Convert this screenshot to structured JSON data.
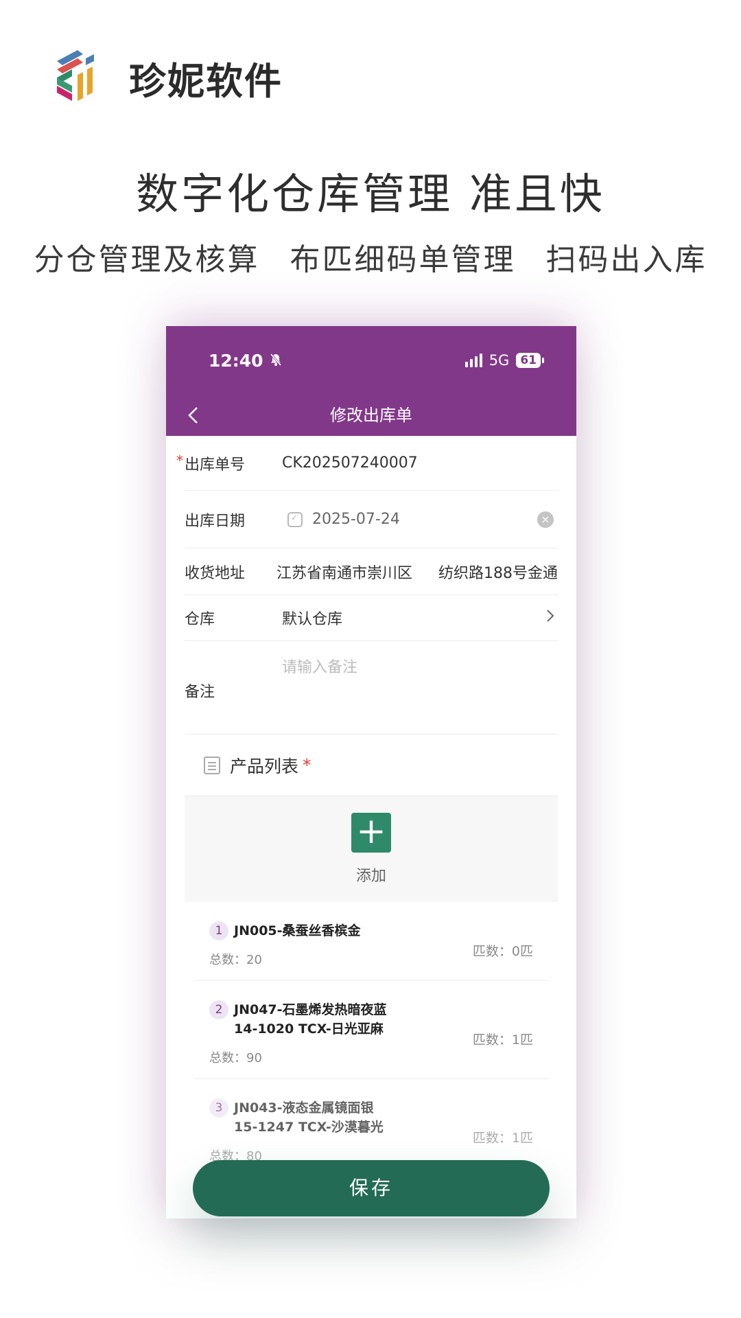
{
  "brand": {
    "name": "珍妮软件",
    "logo_icon": "stacked-stripes-logo-icon"
  },
  "headline": "数字化仓库管理 准且快",
  "features": [
    "分仓管理及核算",
    "布匹细码单管理",
    "扫码出入库"
  ],
  "phone": {
    "status": {
      "time": "12:40",
      "network": "5G",
      "battery": "61",
      "mute_icon": "bell-slash-icon"
    },
    "nav": {
      "title": "修改出库单",
      "back_icon": "chevron-left-icon"
    },
    "form": {
      "order_no": {
        "label": "出库单号",
        "value": "CK202507240007"
      },
      "date": {
        "label": "出库日期",
        "value": "2025-07-24"
      },
      "address": {
        "label": "收货地址",
        "part1": "江苏省南通市崇川区",
        "part2": "纺织路188号金通"
      },
      "warehouse": {
        "label": "仓库",
        "value": "默认仓库"
      },
      "remark": {
        "label": "备注",
        "placeholder": "请输入备注"
      }
    },
    "products": {
      "title": "产品列表",
      "required_mark": "*",
      "add_label": "添加",
      "items": [
        {
          "index": "1",
          "name": "JN005-桑蚕丝香槟金",
          "name2": "",
          "total": "总数：20",
          "pieces": "匹数：0匹"
        },
        {
          "index": "2",
          "name": "JN047-石墨烯发热暗夜蓝",
          "name2": "14-1020 TCX-日光亚麻",
          "total": "总数：90",
          "pieces": "匹数：1匹"
        },
        {
          "index": "3",
          "name": "JN043-液态金属镜面银",
          "name2": "15-1247 TCX-沙漠暮光",
          "total": "总数：80",
          "pieces": "匹数：1匹"
        }
      ]
    },
    "save_label": "保存"
  },
  "colors": {
    "primary": "#823889",
    "save": "#236b54",
    "add": "#2f8a69"
  }
}
